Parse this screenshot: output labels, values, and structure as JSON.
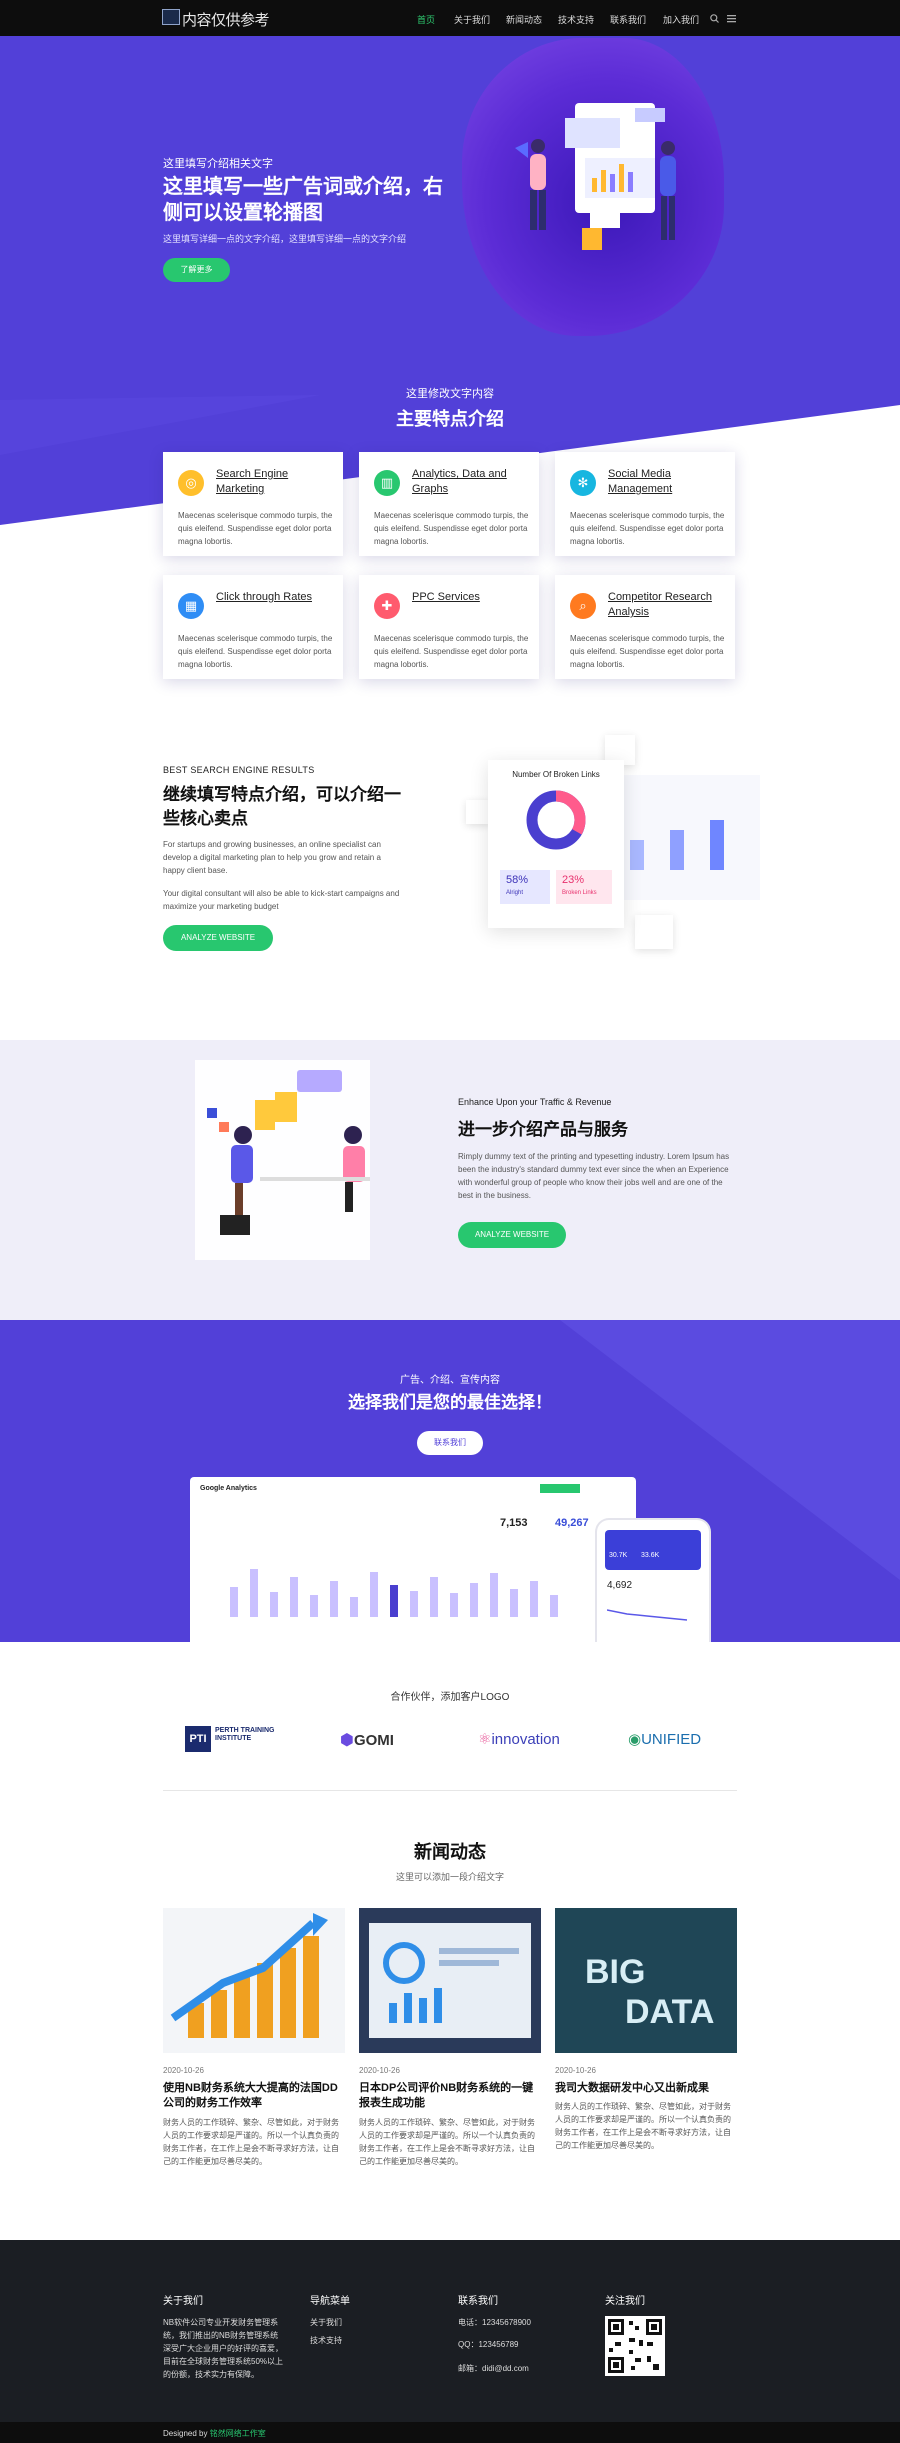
{
  "header": {
    "logo_text": "内容仅供参考",
    "nav": [
      "首页",
      "关于我们",
      "新闻动态",
      "技术支持",
      "联系我们",
      "加入我们"
    ]
  },
  "colors": {
    "accent": "#5240d8",
    "green": "#28c76f",
    "dark": "#1b1e23"
  },
  "hero": {
    "subtitle": "这里填写介绍相关文字",
    "title": "这里填写一些广告词或介绍，右侧可以设置轮播图",
    "desc": "这里填写详细一点的文字介绍，这里填写详细一点的文字介绍",
    "button": "了解更多"
  },
  "features": {
    "subtitle": "这里修改文字内容",
    "title": "主要特点介绍",
    "items": [
      {
        "title": "Search Engine Marketing",
        "desc": "Maecenas scelerisque commodo turpis, the quis eleifend. Suspendisse eget dolor porta magna lobortis.",
        "icon": "target-icon"
      },
      {
        "title": "Analytics, Data and Graphs",
        "desc": "Maecenas scelerisque commodo turpis, the quis eleifend. Suspendisse eget dolor porta magna lobortis.",
        "icon": "chart-icon"
      },
      {
        "title": "Social Media Management",
        "desc": "Maecenas scelerisque commodo turpis, the quis eleifend. Suspendisse eget dolor porta magna lobortis.",
        "icon": "network-icon"
      },
      {
        "title": "Click through Rates",
        "desc": "Maecenas scelerisque commodo turpis, the quis eleifend. Suspendisse eget dolor porta magna lobortis.",
        "icon": "grid-icon"
      },
      {
        "title": "PPC Services",
        "desc": "Maecenas scelerisque commodo turpis, the quis eleifend. Suspendisse eget dolor porta magna lobortis.",
        "icon": "pin-icon"
      },
      {
        "title": "Competitor Research Analysis",
        "desc": "Maecenas scelerisque commodo turpis, the quis eleifend. Suspendisse eget dolor porta magna lobortis.",
        "icon": "magnifier-icon"
      }
    ]
  },
  "section3": {
    "small": "BEST SEARCH ENGINE RESULTS",
    "title": "继续填写特点介绍，可以介绍一些核心卖点",
    "p1": "For startups and growing businesses, an online specialist can develop a digital marketing plan to help you grow and retain a happy client base.",
    "p2": "Your digital consultant will also be able to kick-start campaigns and maximize your marketing budget",
    "button": "ANALYZE WEBSITE",
    "widget": {
      "title": "Number Of Broken Links",
      "stat1": "58%",
      "stat1_label": "Alright",
      "stat2": "23%",
      "stat2_label": "Broken Links"
    }
  },
  "section4": {
    "small": "Enhance Upon your Traffic & Revenue",
    "title": "进一步介绍产品与服务",
    "p": "Rimply dummy text of the printing and typesetting industry. Lorem Ipsum has been the industry's standard dummy text ever since the when an Experience with wonderful group of people who know their jobs well and are one of the best in the business.",
    "button": "ANALYZE WEBSITE"
  },
  "section5": {
    "small": "广告、介绍、宣传内容",
    "title": "选择我们是您的最佳选择！",
    "button": "联系我们",
    "dashboard": {
      "title": "Google Analytics",
      "stat1": "7,153",
      "stat2": "49,267",
      "phone_stat1": "30.7K",
      "phone_stat2": "33.6K",
      "phone_stat3": "4,692"
    }
  },
  "partners": {
    "title": "合作伙伴，添加客户LOGO",
    "logos": [
      "PERTH TRAINING INSTITUTE",
      "GOMI",
      "innovation",
      "UNIFIED"
    ]
  },
  "news": {
    "title": "新闻动态",
    "subtitle": "这里可以添加一段介绍文字",
    "items": [
      {
        "date": "2020-10-26",
        "title": "使用NB财务系统大大提高的法国DD公司的财务工作效率",
        "desc": "财务人员的工作琐碎、繁杂、尽管如此，对于财务人员的工作要求却是严谨的。所以一个认真负责的财务工作者，在工作上是会不断寻求好方法，让自己的工作能更加尽善尽美的。"
      },
      {
        "date": "2020-10-26",
        "title": "日本DP公司评价NB财务系统的一键报表生成功能",
        "desc": "财务人员的工作琐碎、繁杂、尽管如此，对于财务人员的工作要求却是严谨的。所以一个认真负责的财务工作者，在工作上是会不断寻求好方法，让自己的工作能更加尽善尽美的。"
      },
      {
        "date": "2020-10-26",
        "title": "我司大数据研发中心又出新成果",
        "desc": "财务人员的工作琐碎、繁杂、尽管如此，对于财务人员的工作要求却是严谨的。所以一个认真负责的财务工作者，在工作上是会不断寻求好方法，让自己的工作能更加尽善尽美的。"
      }
    ]
  },
  "footer": {
    "about_title": "关于我们",
    "about_text": "NB软件公司专业开发财务管理系统，我们推出的NB财务管理系统深受广大企业用户的好评的喜爱，目前在全球财务管理系统50%以上的份额，技术实力有保障。",
    "nav_title": "导航菜单",
    "nav_items": [
      "关于我们",
      "技术支持"
    ],
    "contact_title": "联系我们",
    "phone": "电话：12345678900",
    "qq": "QQ：123456789",
    "email": "邮箱：didi@dd.com",
    "follow_title": "关注我们",
    "copyright": "Designed by",
    "copyright_link": "铭然网络工作室"
  }
}
